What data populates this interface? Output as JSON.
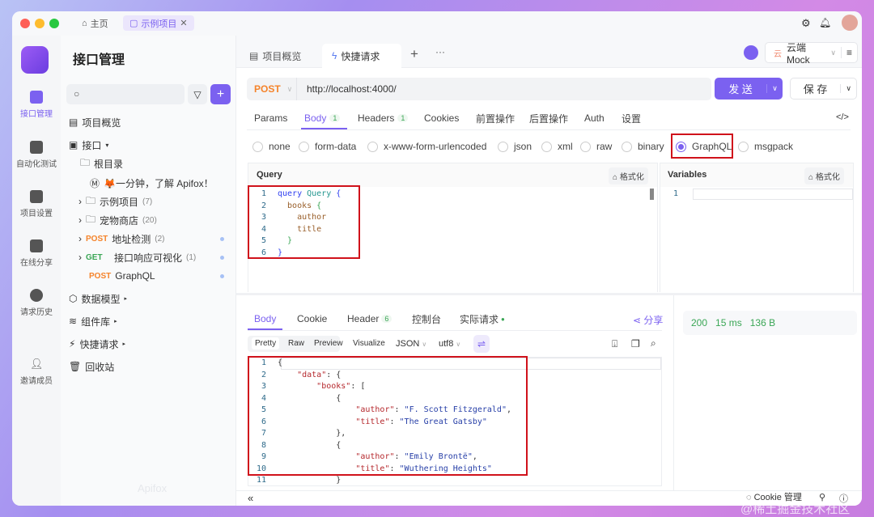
{
  "titlebar": {
    "home_tab": "主页",
    "project_tab": "示例项目"
  },
  "rail": {
    "items": [
      {
        "label": "接口管理"
      },
      {
        "label": "自动化测试"
      },
      {
        "label": "项目设置"
      },
      {
        "label": "在线分享"
      },
      {
        "label": "请求历史"
      },
      {
        "label": "邀请成员"
      }
    ]
  },
  "sidebar": {
    "title": "接口管理",
    "search_placeholder": "",
    "overview": "项目概览",
    "api_root": "接口",
    "root_dir": "根目录",
    "intro_doc": "🦊一分钟，了解 Apifox！",
    "folders": [
      {
        "label": "示例项目",
        "count": "(7)"
      },
      {
        "label": "宠物商店",
        "count": "(20)"
      }
    ],
    "endpoints": [
      {
        "method": "POST",
        "label": "地址检测",
        "count": "(2)"
      },
      {
        "method": "GET",
        "label": "接口响应可视化",
        "count": "(1)"
      },
      {
        "method": "POST",
        "label": "GraphQL",
        "count": ""
      }
    ],
    "sections": [
      "数据模型",
      "组件库",
      "快捷请求",
      "回收站"
    ],
    "watermark": "Apifox"
  },
  "tabs": {
    "overview": "项目概览",
    "quick": "快捷请求",
    "env": "云端 Mock",
    "env_icon": "云"
  },
  "request": {
    "method": "POST",
    "url": "http://localhost:4000/",
    "send": "发 送",
    "save": "保 存",
    "tabs": [
      {
        "label": "Params",
        "badge": ""
      },
      {
        "label": "Body",
        "badge": "1"
      },
      {
        "label": "Headers",
        "badge": "1"
      },
      {
        "label": "Cookies",
        "badge": ""
      },
      {
        "label": "前置操作",
        "badge": ""
      },
      {
        "label": "后置操作",
        "badge": ""
      },
      {
        "label": "Auth",
        "badge": ""
      },
      {
        "label": "设置",
        "badge": ""
      }
    ],
    "body_types": [
      "none",
      "form-data",
      "x-www-form-urlencoded",
      "json",
      "xml",
      "raw",
      "binary",
      "GraphQL",
      "msgpack"
    ],
    "selected_body_type": "GraphQL"
  },
  "query": {
    "title": "Query",
    "format": "格式化",
    "lines": [
      [
        [
          "query ",
          "k"
        ],
        [
          "Query ",
          "t"
        ],
        [
          "{",
          "k"
        ]
      ],
      [
        [
          "  books ",
          "f"
        ],
        [
          "{",
          "p"
        ]
      ],
      [
        [
          "    author",
          "f"
        ]
      ],
      [
        [
          "    title",
          "f"
        ]
      ],
      [
        [
          "  }",
          "p"
        ]
      ],
      [
        [
          "}",
          "k"
        ]
      ]
    ]
  },
  "variables": {
    "title": "Variables",
    "format": "格式化",
    "lines": [
      [
        [
          "",
          ""
        ]
      ]
    ]
  },
  "response": {
    "tabs": [
      {
        "label": "Body"
      },
      {
        "label": "Cookie"
      },
      {
        "label": "Header",
        "badge": "6"
      },
      {
        "label": "控制台"
      },
      {
        "label": "实际请求"
      }
    ],
    "share": "分享",
    "views": [
      "Pretty",
      "Raw",
      "Preview",
      "Visualize"
    ],
    "format": "JSON",
    "encoding": "utf8",
    "status": "200",
    "time": "15 ms",
    "size": "136 B",
    "lines": [
      [
        [
          "{",
          "o"
        ]
      ],
      [
        [
          "    ",
          ""
        ],
        [
          "\"data\"",
          "s"
        ],
        [
          ": {",
          "o"
        ]
      ],
      [
        [
          "        ",
          ""
        ],
        [
          "\"books\"",
          "s"
        ],
        [
          ": [",
          "o"
        ]
      ],
      [
        [
          "            {",
          "o"
        ]
      ],
      [
        [
          "                ",
          ""
        ],
        [
          "\"author\"",
          "s"
        ],
        [
          ": ",
          "o"
        ],
        [
          "\"F. Scott Fitzgerald\"",
          "v"
        ],
        [
          ",",
          "o"
        ]
      ],
      [
        [
          "                ",
          ""
        ],
        [
          "\"title\"",
          "s"
        ],
        [
          ": ",
          "o"
        ],
        [
          "\"The Great Gatsby\"",
          "v"
        ]
      ],
      [
        [
          "            },",
          "o"
        ]
      ],
      [
        [
          "            {",
          "o"
        ]
      ],
      [
        [
          "                ",
          ""
        ],
        [
          "\"author\"",
          "s"
        ],
        [
          ": ",
          "o"
        ],
        [
          "\"Emily Brontë\"",
          "v"
        ],
        [
          ",",
          "o"
        ]
      ],
      [
        [
          "                ",
          ""
        ],
        [
          "\"title\"",
          "s"
        ],
        [
          ": ",
          "o"
        ],
        [
          "\"Wuthering Heights\"",
          "v"
        ]
      ],
      [
        [
          "            }",
          "o"
        ]
      ]
    ]
  },
  "footer": {
    "cookie": "Cookie 管理"
  },
  "watermark": "@稀土掘金技术社区",
  "colors": {
    "accent": "#7b61f0",
    "post": "#f5832a",
    "get": "#3aa655",
    "highlight": "#d0121b"
  }
}
